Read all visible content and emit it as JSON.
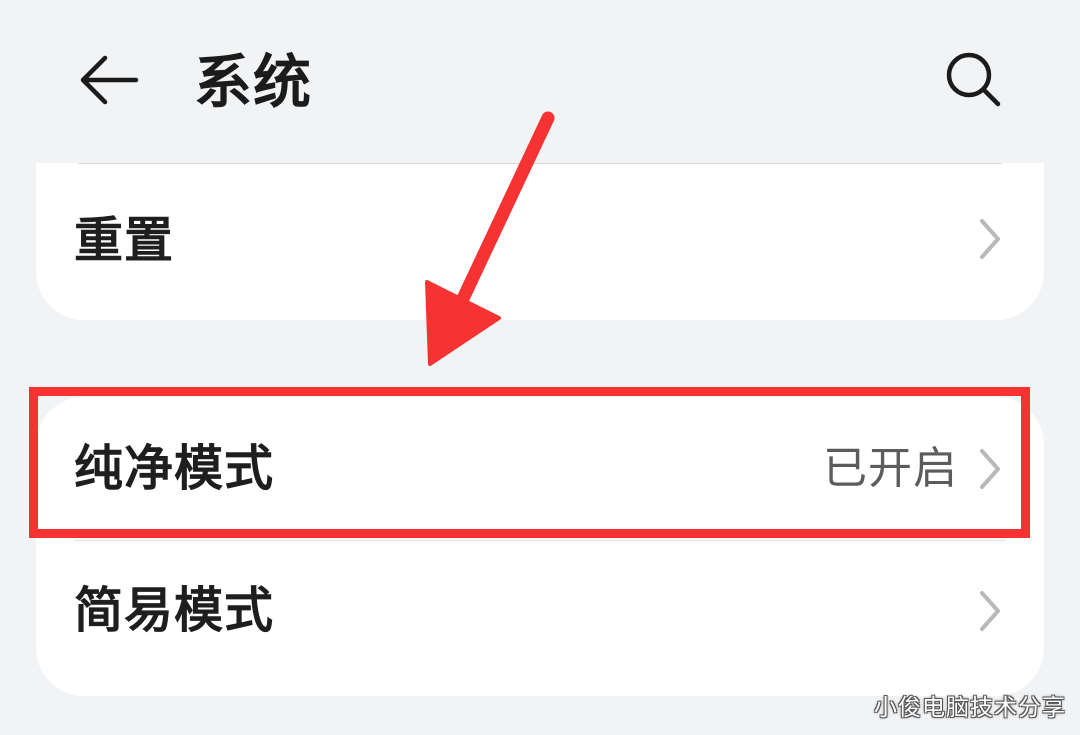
{
  "header": {
    "title": "系统",
    "back_icon": "arrow-left-icon",
    "search_icon": "search-icon"
  },
  "settings": {
    "reset_label": "重置",
    "pure_mode": {
      "label": "纯净模式",
      "status": "已开启"
    },
    "simple_mode_label": "简易模式"
  },
  "annotation": {
    "highlight_color": "#f73232",
    "arrow_color": "#f73232"
  },
  "watermark": "小俊电脑技术分享",
  "colors": {
    "background": "#f1f3f5",
    "card": "#ffffff",
    "text_primary": "#1e1e1e",
    "text_secondary": "#5c5c5c",
    "chevron": "#b9b9b9"
  }
}
